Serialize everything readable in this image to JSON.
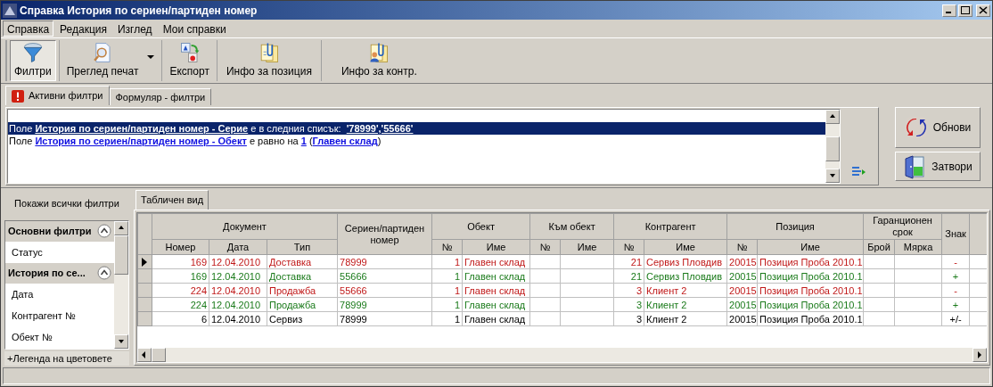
{
  "window": {
    "title": "Справка История по сериен/партиден номер"
  },
  "menu": [
    {
      "label": "Справка",
      "selected": true
    },
    {
      "label": "Редакция",
      "selected": false
    },
    {
      "label": "Изглед",
      "selected": false
    },
    {
      "label": "Мои справки",
      "selected": false
    }
  ],
  "toolbar": [
    {
      "label": "Филтри",
      "kind": "filter",
      "pressed": true,
      "dropdown": false
    },
    {
      "label": "Преглед печат",
      "kind": "preview",
      "pressed": false,
      "dropdown": true
    },
    {
      "label": "Експорт",
      "kind": "export",
      "pressed": false,
      "dropdown": false
    },
    {
      "label": "Инфо за позиция",
      "kind": "info",
      "pressed": false,
      "dropdown": false
    },
    {
      "label": "Инфо за контр.",
      "kind": "contact",
      "pressed": false,
      "dropdown": false
    }
  ],
  "filter_tabs": [
    {
      "label": "Активни филтри",
      "selected": true,
      "warning": true
    },
    {
      "label": "Формуляр - филтри",
      "selected": false,
      "warning": false
    }
  ],
  "filter_lines": [
    {
      "selected": true,
      "parts": [
        {
          "kind": "plain",
          "text": "Поле "
        },
        {
          "kind": "link",
          "text": "История по сериен/партиден номер - Серие"
        },
        {
          "kind": "plain",
          "text": " е в следния списък:  "
        },
        {
          "kind": "link",
          "text": "'78999','55666'"
        }
      ]
    },
    {
      "selected": false,
      "parts": [
        {
          "kind": "plain",
          "text": "Поле "
        },
        {
          "kind": "link",
          "text": "История по сериен/партиден номер - Обект"
        },
        {
          "kind": "plain",
          "text": " е равно на "
        },
        {
          "kind": "link",
          "text": "1"
        },
        {
          "kind": "plain",
          "text": " ("
        },
        {
          "kind": "link",
          "text": "Главен склад"
        },
        {
          "kind": "plain",
          "text": ")"
        }
      ]
    }
  ],
  "side_buttons": [
    {
      "label": "Обнови",
      "kind": "refresh"
    },
    {
      "label": "Затвори",
      "kind": "close"
    }
  ],
  "show_all_filters": "Покажи всички филтри",
  "filter_groups": [
    {
      "title": "Основни филтри",
      "expanded": true,
      "items": [
        "Статус"
      ]
    },
    {
      "title": "История по се...",
      "expanded": true,
      "items": [
        "Дата",
        "Контрагент №",
        "Обект №"
      ]
    }
  ],
  "legend": "+Легенда на цветовете",
  "view_tabs": [
    {
      "label": "Табличен вид",
      "selected": true
    }
  ],
  "table": {
    "column_groups": [
      {
        "label": "Документ",
        "columns": [
          "Номер",
          "Дата",
          "Тип"
        ]
      },
      {
        "label": "Сериен/партиден номер"
      },
      {
        "label": "Обект",
        "columns": [
          "№",
          "Име"
        ]
      },
      {
        "label": "Към обект",
        "columns": [
          "№",
          "Име"
        ]
      },
      {
        "label": "Контрагент",
        "columns": [
          "№",
          "Име"
        ]
      },
      {
        "label": "Позиция",
        "columns": [
          "№",
          "Име"
        ]
      },
      {
        "label": "Гаранционен срок",
        "columns": [
          "Брой",
          "Мярка"
        ]
      },
      {
        "label": "Знак"
      }
    ],
    "rows": [
      {
        "selected": true,
        "kind": "outgoing",
        "cells": [
          "169",
          "12.04.2010",
          "Доставка",
          "78999",
          "1",
          "Главен склад",
          null,
          null,
          "21",
          "Сервиз Пловдив",
          "20015",
          "Позиция Проба 2010.1",
          null,
          null,
          "-"
        ]
      },
      {
        "selected": false,
        "kind": "incoming",
        "cells": [
          "169",
          "12.04.2010",
          "Доставка",
          "55666",
          "1",
          "Главен склад",
          null,
          null,
          "21",
          "Сервиз Пловдив",
          "20015",
          "Позиция Проба 2010.1",
          null,
          null,
          "+"
        ]
      },
      {
        "selected": false,
        "kind": "outgoing",
        "cells": [
          "224",
          "12.04.2010",
          "Продажба",
          "55666",
          "1",
          "Главен склад",
          null,
          null,
          "3",
          "Клиент 2",
          "20015",
          "Позиция Проба 2010.1",
          null,
          null,
          "-"
        ]
      },
      {
        "selected": false,
        "kind": "incoming",
        "cells": [
          "224",
          "12.04.2010",
          "Продажба",
          "78999",
          "1",
          "Главен склад",
          null,
          null,
          "3",
          "Клиент 2",
          "20015",
          "Позиция Проба 2010.1",
          null,
          null,
          "+"
        ]
      },
      {
        "selected": false,
        "kind": "service",
        "cells": [
          "6",
          "12.04.2010",
          "Сервиз",
          "78999",
          "1",
          "Главен склад",
          null,
          null,
          "3",
          "Клиент 2",
          "20015",
          "Позиция Проба 2010.1",
          null,
          null,
          "+/-"
        ]
      }
    ]
  }
}
